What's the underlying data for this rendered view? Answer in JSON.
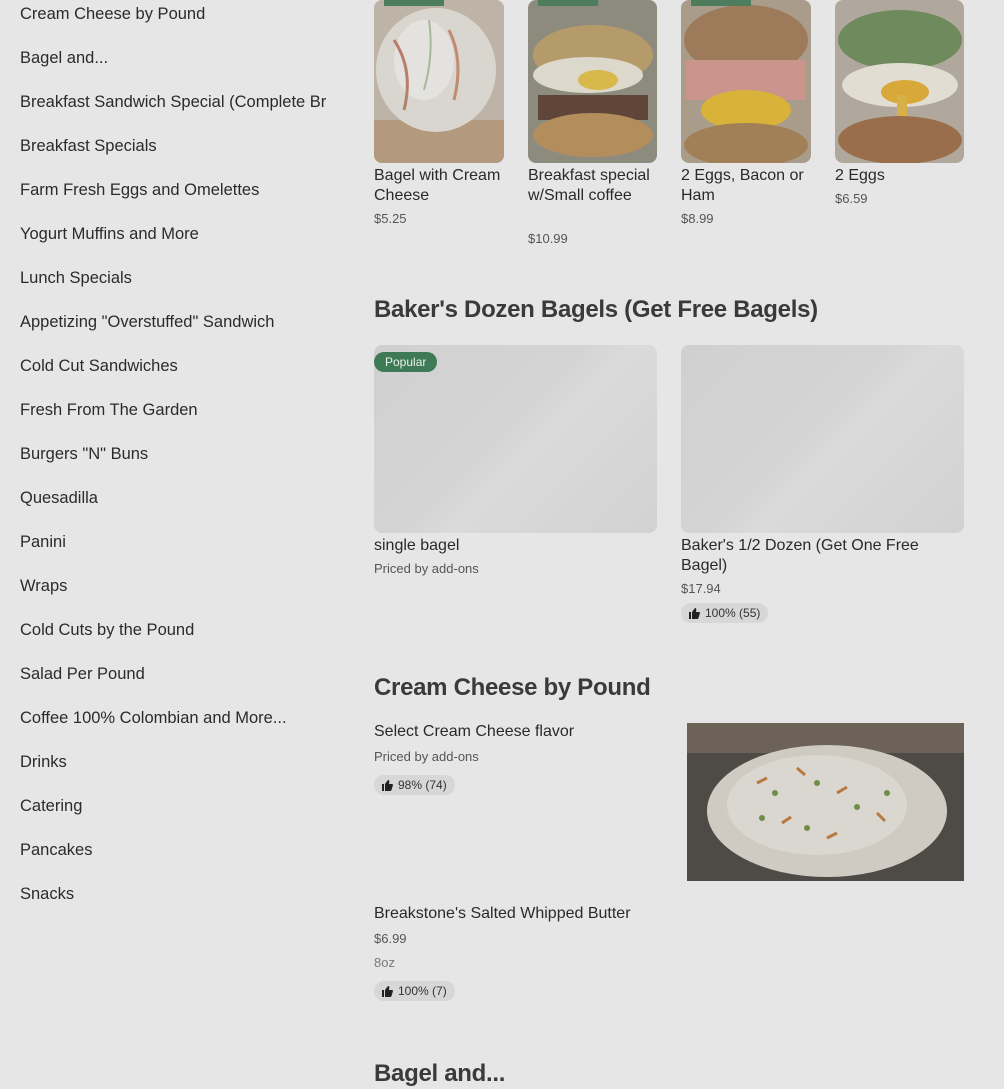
{
  "sidebar": {
    "items": [
      "Cream Cheese by Pound",
      "Bagel and...",
      "Breakfast Sandwich Special (Complete Breakfast)",
      "Breakfast Specials",
      "Farm Fresh Eggs and Omelettes",
      "Yogurt Muffins and More",
      "Lunch Specials",
      "Appetizing \"Overstuffed\" Sandwich",
      "Cold Cut Sandwiches",
      "Fresh From The Garden",
      "Burgers \"N\" Buns",
      "Quesadilla",
      "Panini",
      "Wraps",
      "Cold Cuts by the Pound",
      "Salad Per Pound",
      "Coffee 100% Colombian and More...",
      "Drinks",
      "Catering",
      "Pancakes",
      "Snacks"
    ]
  },
  "top_cards": [
    {
      "title": "Bagel with Cream Cheese",
      "price": "$5.25"
    },
    {
      "title": "Breakfast special w/Small coffee",
      "price": "$10.99"
    },
    {
      "title": "2 Eggs, Bacon or Ham",
      "price": "$8.99"
    },
    {
      "title": "2 Eggs",
      "price": "$6.59"
    }
  ],
  "bakers": {
    "title": "Baker's Dozen Bagels (Get Free Bagels)",
    "items": [
      {
        "badge": "Popular",
        "title": "single bagel",
        "price": "Priced by add-ons"
      },
      {
        "title": "Baker's 1/2 Dozen (Get One Free Bagel)",
        "price": "$17.94",
        "rating": "100% (55)"
      }
    ]
  },
  "cream_cheese": {
    "title": "Cream Cheese by Pound",
    "items": [
      {
        "title": "Select Cream Cheese flavor",
        "price": "Priced by add-ons",
        "rating": "98% (74)"
      },
      {
        "title": "Breakstone's Salted Whipped Butter",
        "price": "$6.99",
        "note": "8oz",
        "rating": "100% (7)"
      }
    ]
  },
  "next_section": {
    "title": "Bagel and..."
  },
  "colors": {
    "background": "#e6e6e6",
    "badge": "#3f7a57",
    "rating_bg": "#d7d7d7"
  }
}
